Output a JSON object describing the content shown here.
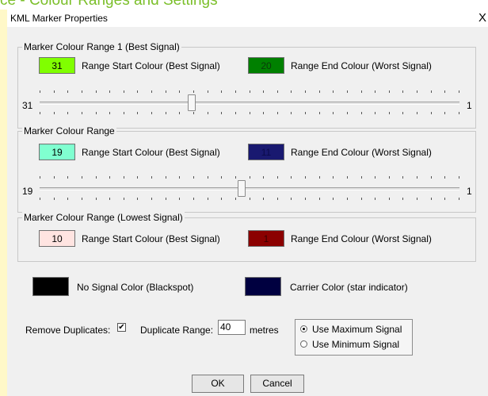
{
  "backdrop": {
    "heading": "ce - Colour Ranges and Settings"
  },
  "window": {
    "title": "KML Marker Properties",
    "close_glyph": "X"
  },
  "ranges": [
    {
      "legend": "Marker Colour Range 1 (Best Signal)",
      "start": {
        "value": "31",
        "color": "#80ff00",
        "label": "Range Start Colour (Best Signal)"
      },
      "end": {
        "value": "20",
        "color": "#008000",
        "label": "Range End Colour (Worst Signal)"
      },
      "slider": {
        "min_label": "31",
        "max_label": "1",
        "position_fraction": 0.36
      }
    },
    {
      "legend": "Marker Colour Range",
      "start": {
        "value": "19",
        "color": "#80ffd0",
        "label": "Range Start Colour (Best Signal)"
      },
      "end": {
        "value": "11",
        "color": "#191970",
        "label": "Range End Colour (Worst Signal)"
      },
      "slider": {
        "min_label": "19",
        "max_label": "1",
        "position_fraction": 0.48
      }
    },
    {
      "legend": "Marker Colour Range (Lowest Signal)",
      "start": {
        "value": "10",
        "color": "#ffe4e1",
        "label": "Range Start Colour (Best Signal)"
      },
      "end": {
        "value": "1",
        "color": "#8b0000",
        "label": "Range End Colour (Worst Signal)"
      }
    }
  ],
  "no_signal": {
    "label": "No Signal Color (Blackspot)",
    "color": "#000000"
  },
  "carrier": {
    "label": "Carrier Color (star indicator)",
    "color": "#000040"
  },
  "options": {
    "remove_duplicates_label": "Remove Duplicates:",
    "remove_duplicates_checked": true,
    "check_glyph": "✔",
    "duplicate_range_label": "Duplicate Range:",
    "duplicate_range_value": "40",
    "units_label": "metres",
    "signal_choice": [
      {
        "label": "Use Maximum Signal",
        "selected": true
      },
      {
        "label": "Use Minimum Signal",
        "selected": false
      }
    ]
  },
  "buttons": {
    "ok": "OK",
    "cancel": "Cancel"
  }
}
